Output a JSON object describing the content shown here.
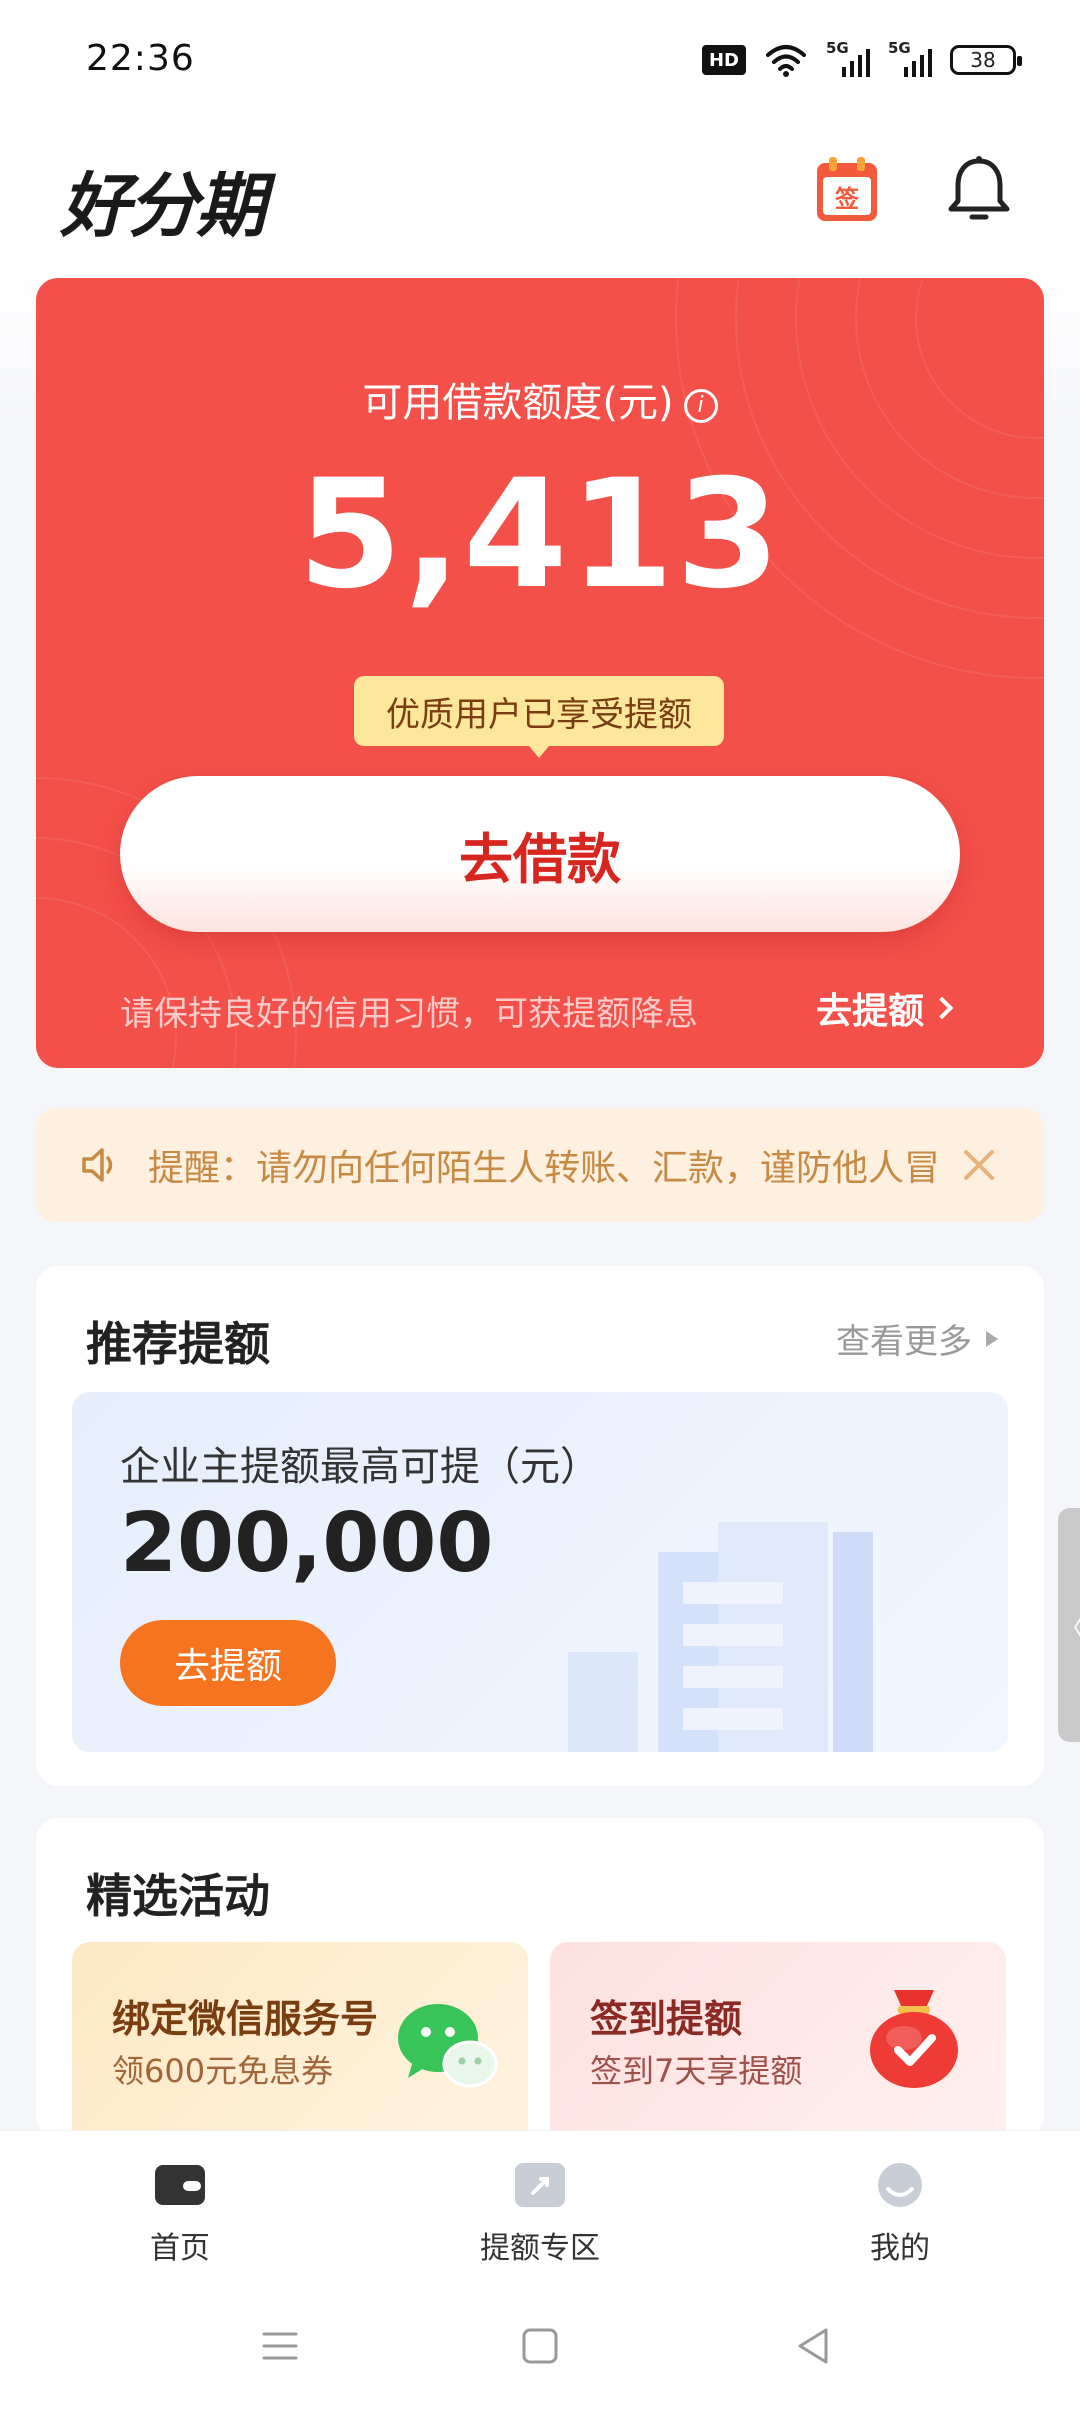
{
  "status_bar": {
    "time": "22:36",
    "hd_label": "HD",
    "sim1_label": "5G",
    "sim2_label": "5G",
    "battery_level": "38",
    "icons": [
      "hd-icon",
      "wifi-icon",
      "signal-5g-icon",
      "signal-5g-icon",
      "battery-icon"
    ]
  },
  "header": {
    "logo_text": "好分期",
    "calendar_icon_label": "签",
    "icons": [
      "calendar-sign-icon",
      "bell-icon"
    ]
  },
  "hero": {
    "label": "可用借款额度(元)",
    "info_icon": "i",
    "amount": "5,413",
    "badge": "优质用户已享受提额",
    "borrow_button": "去借款",
    "tip": "请保持良好的信用习惯，可获提额降息",
    "raise_link": "去提额",
    "colors": {
      "background": "#f4504a",
      "badge": "#fde79a",
      "button_text": "#d7261f"
    }
  },
  "notice": {
    "text": "提醒：请勿向任何陌生人转账、汇款，谨防他人冒",
    "icons": [
      "speaker-icon",
      "close-icon"
    ]
  },
  "recommend": {
    "title": "推荐提额",
    "more": "查看更多",
    "label": "企业主提额最高可提（元）",
    "amount": "200,000",
    "button": "去提额",
    "button_color": "#f6741f"
  },
  "activities": {
    "title": "精选活动",
    "items": [
      {
        "title": "绑定微信服务号",
        "subtitle": "领600元免息券",
        "icon": "wechat-icon"
      },
      {
        "title": "签到提额",
        "subtitle": "签到7天享提额",
        "icon": "red-bag-check-icon"
      }
    ]
  },
  "bottom_nav": {
    "items": [
      {
        "label": "首页",
        "icon": "wallet-icon"
      },
      {
        "label": "提额专区",
        "icon": "raise-icon"
      },
      {
        "label": "我的",
        "icon": "profile-icon"
      }
    ]
  },
  "system_nav": {
    "icons": [
      "menu-icon",
      "home-square-icon",
      "back-triangle-icon"
    ]
  }
}
